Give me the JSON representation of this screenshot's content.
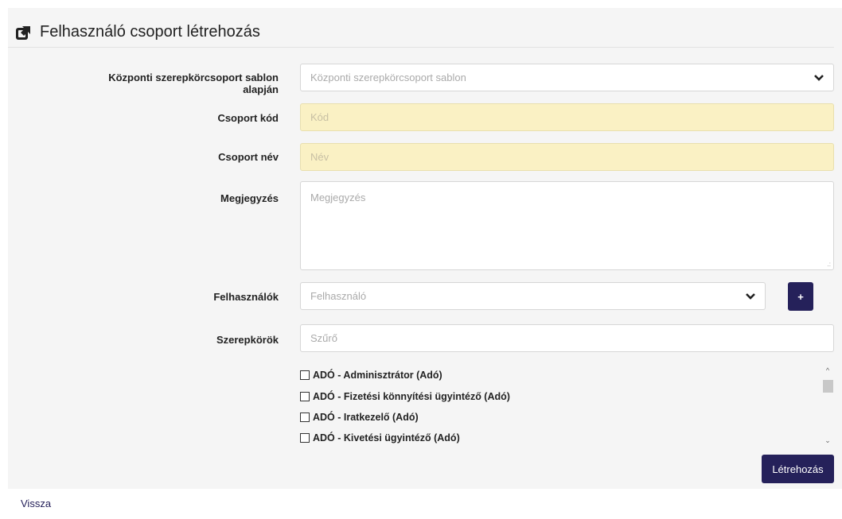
{
  "header": {
    "title": "Felhasználó csoport létrehozás",
    "icon": "external-link-icon"
  },
  "form": {
    "template": {
      "label": "Központi szerepkörcsoport sablon alapján",
      "placeholder": "Központi szerepkörcsoport sablon"
    },
    "code": {
      "label": "Csoport kód",
      "placeholder": "Kód"
    },
    "name": {
      "label": "Csoport név",
      "placeholder": "Név"
    },
    "note": {
      "label": "Megjegyzés",
      "placeholder": "Megjegyzés"
    },
    "users": {
      "label": "Felhasználók",
      "placeholder": "Felhasználó",
      "add_label": "+"
    },
    "roles": {
      "label": "Szerepkörök",
      "filter_placeholder": "Szűrő",
      "items": [
        "ADÓ - Adminisztrátor (Adó)",
        "ADÓ - Fizetési könnyítési ügyintéző (Adó)",
        "ADÓ - Iratkezelő (Adó)",
        "ADÓ - Kivetési ügyintéző (Adó)"
      ]
    }
  },
  "actions": {
    "create_label": "Létrehozás",
    "back_label": "Vissza"
  },
  "colors": {
    "primary": "#25215a",
    "required_field_bg": "#faf1c4",
    "panel_bg": "#f5f5f5"
  }
}
